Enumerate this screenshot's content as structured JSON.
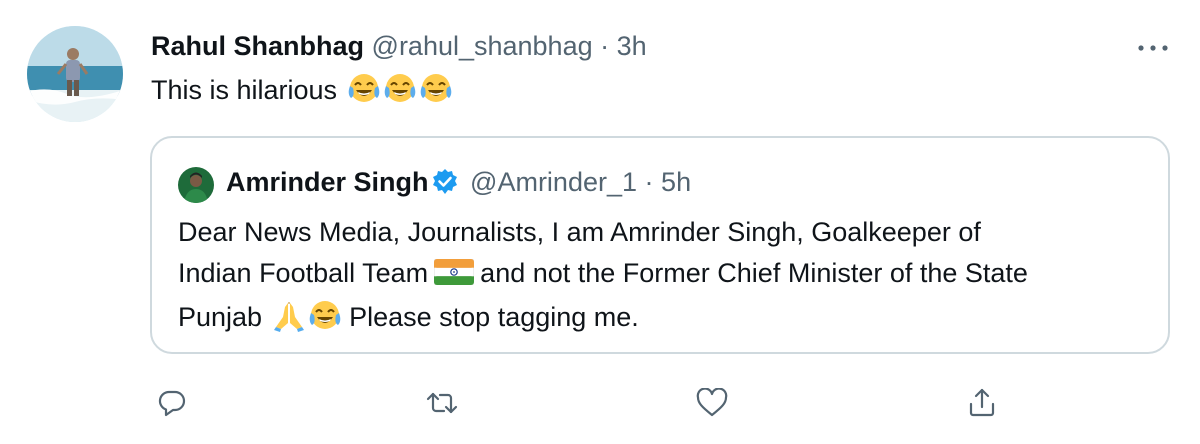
{
  "tweet": {
    "author_name": "Rahul Shanbhag",
    "author_handle": "@rahul_shanbhag",
    "separator": "·",
    "time": "3h",
    "text": "This is hilarious",
    "emojis": [
      "face-with-tears-of-joy",
      "face-with-tears-of-joy",
      "face-with-tears-of-joy"
    ]
  },
  "quoted_tweet": {
    "author_name": "Amrinder Singh",
    "verified": true,
    "author_handle": "@Amrinder_1",
    "separator": "·",
    "time": "5h",
    "line1": "Dear News Media, Journalists, I am Amrinder Singh, Goalkeeper of",
    "line2a": "Indian Football Team",
    "line2b": "and not the Former Chief Minister of the State",
    "line3a": "Punjab",
    "line3b": "Please stop tagging me.",
    "inline_emojis": [
      "flag-india",
      "folded-hands",
      "face-with-tears-of-joy"
    ]
  },
  "actions": [
    "reply-icon",
    "retweet-icon",
    "like-icon",
    "share-icon"
  ],
  "colors": {
    "text": "#0f1419",
    "secondary": "#536471",
    "border": "#cfd9de",
    "verified": "#1d9bf0"
  }
}
